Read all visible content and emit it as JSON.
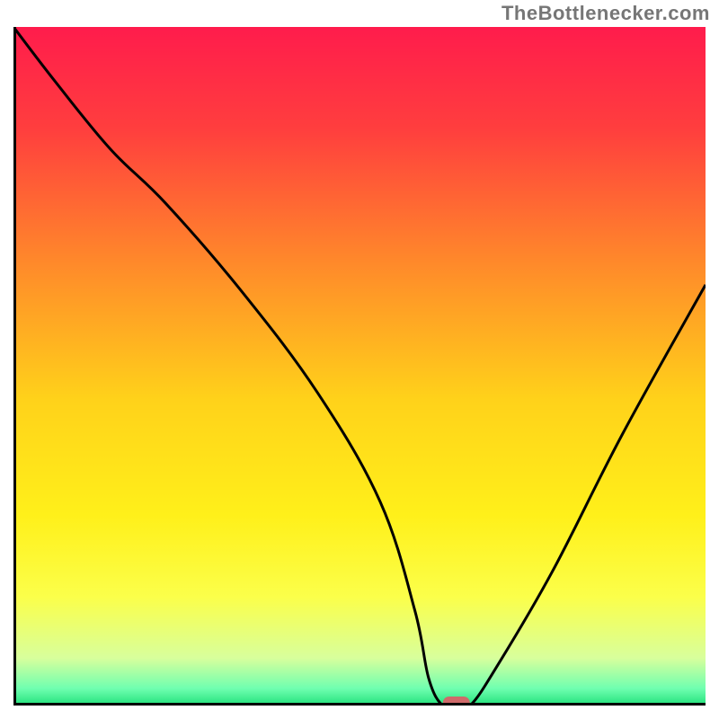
{
  "attribution": "TheBottlenecker.com",
  "chart_data": {
    "type": "line",
    "title": "",
    "xlabel": "",
    "ylabel": "",
    "xlim": [
      0,
      100
    ],
    "ylim": [
      0,
      100
    ],
    "grid": false,
    "legend": false,
    "background": {
      "type": "vertical_gradient",
      "stops": [
        {
          "pos": 0.0,
          "color": "#ff1c4c"
        },
        {
          "pos": 0.15,
          "color": "#ff3e3e"
        },
        {
          "pos": 0.35,
          "color": "#ff8a2a"
        },
        {
          "pos": 0.55,
          "color": "#ffd21a"
        },
        {
          "pos": 0.72,
          "color": "#fff01a"
        },
        {
          "pos": 0.84,
          "color": "#fbff4a"
        },
        {
          "pos": 0.93,
          "color": "#d8ff9c"
        },
        {
          "pos": 0.975,
          "color": "#6fffb0"
        },
        {
          "pos": 1.0,
          "color": "#22e07a"
        }
      ]
    },
    "series": [
      {
        "name": "bottleneck-curve",
        "x": [
          0,
          6,
          14,
          22,
          33,
          44,
          53,
          58,
          60,
          62,
          64,
          66,
          70,
          78,
          88,
          100
        ],
        "y": [
          100,
          92,
          82,
          74,
          61,
          46,
          30,
          14,
          4,
          0,
          0,
          0,
          6,
          20,
          40,
          62
        ]
      }
    ],
    "marker": {
      "name": "optimal-point",
      "x": 64,
      "y": 0,
      "color": "#cf6a6a"
    }
  }
}
